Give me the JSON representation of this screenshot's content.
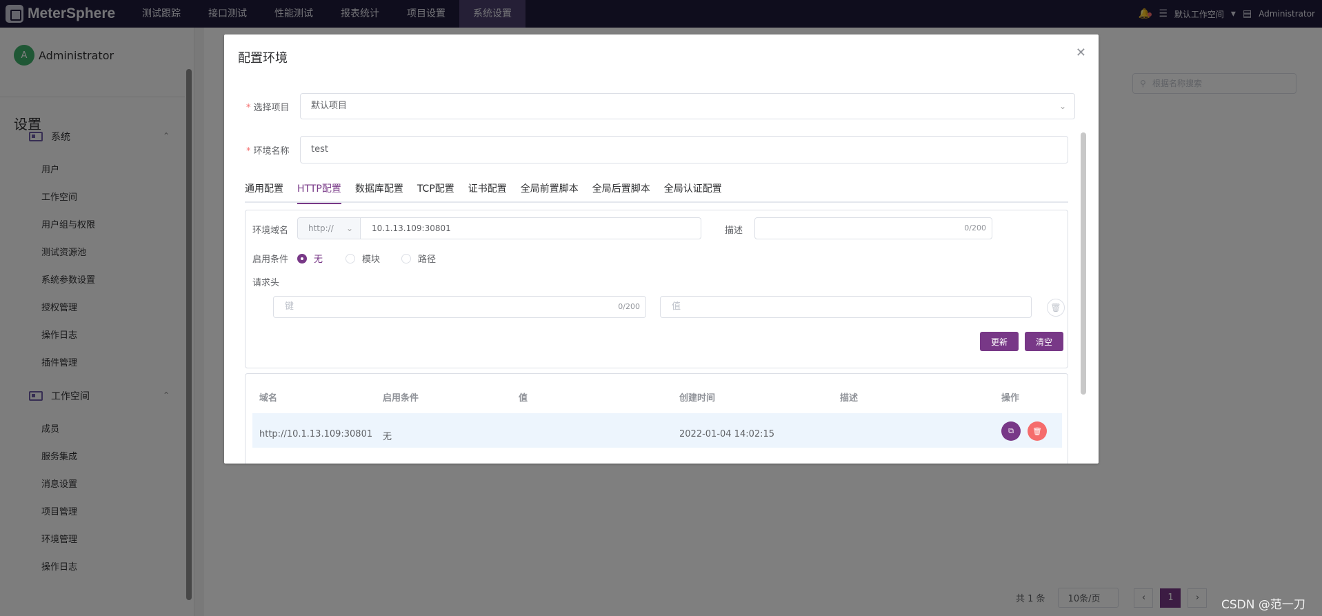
{
  "app": {
    "logo": "MeterSphere",
    "nav": [
      "测试跟踪",
      "接口测试",
      "性能测试",
      "报表统计",
      "项目设置",
      "系统设置"
    ],
    "nav_active_index": 5,
    "workspace": "默认工作空间",
    "user": "Administrator"
  },
  "sidebar": {
    "user_avatar": "A",
    "user_name": "Administrator",
    "title": "设置",
    "system_group": "系统",
    "system_items": [
      "用户",
      "工作空间",
      "用户组与权限",
      "测试资源池",
      "系统参数设置",
      "授权管理",
      "操作日志",
      "插件管理"
    ],
    "workspace_group": "工作空间",
    "workspace_items": [
      "成员",
      "服务集成",
      "消息设置",
      "项目管理",
      "环境管理",
      "操作日志"
    ]
  },
  "background": {
    "search_placeholder": "根据名称搜索",
    "pager_total": "共 1 条",
    "page_size": "10条/页",
    "current_page": "1"
  },
  "dialog": {
    "title": "配置环境",
    "project_label": "选择项目",
    "project_value": "默认项目",
    "env_name_label": "环境名称",
    "env_name_value": "test",
    "tabs": [
      "通用配置",
      "HTTP配置",
      "数据库配置",
      "TCP配置",
      "证书配置",
      "全局前置脚本",
      "全局后置脚本",
      "全局认证配置"
    ],
    "active_tab_index": 1,
    "http": {
      "domain_label": "环境域名",
      "protocol": "http://",
      "domain_value": "10.1.13.109:30801",
      "desc_label": "描述",
      "desc_counter": "0/200",
      "condition_label": "启用条件",
      "conditions": [
        "无",
        "模块",
        "路径"
      ],
      "condition_selected": 0,
      "headers_label": "请求头",
      "key_placeholder": "键",
      "key_counter": "0/200",
      "value_placeholder": "值",
      "update_button": "更新",
      "clear_button": "清空"
    },
    "table": {
      "headers": [
        "域名",
        "启用条件",
        "值",
        "创建时间",
        "描述",
        "操作"
      ],
      "rows": [
        {
          "domain": "http://10.1.13.109:30801",
          "condition": "无",
          "value": "",
          "created": "2022-01-04 14:02:15",
          "desc": ""
        }
      ]
    }
  },
  "watermark": "CSDN @范一刀",
  "colors": {
    "primary": "#783887",
    "danger": "#f56c6c",
    "nav_bg": "#1f1b3b"
  }
}
